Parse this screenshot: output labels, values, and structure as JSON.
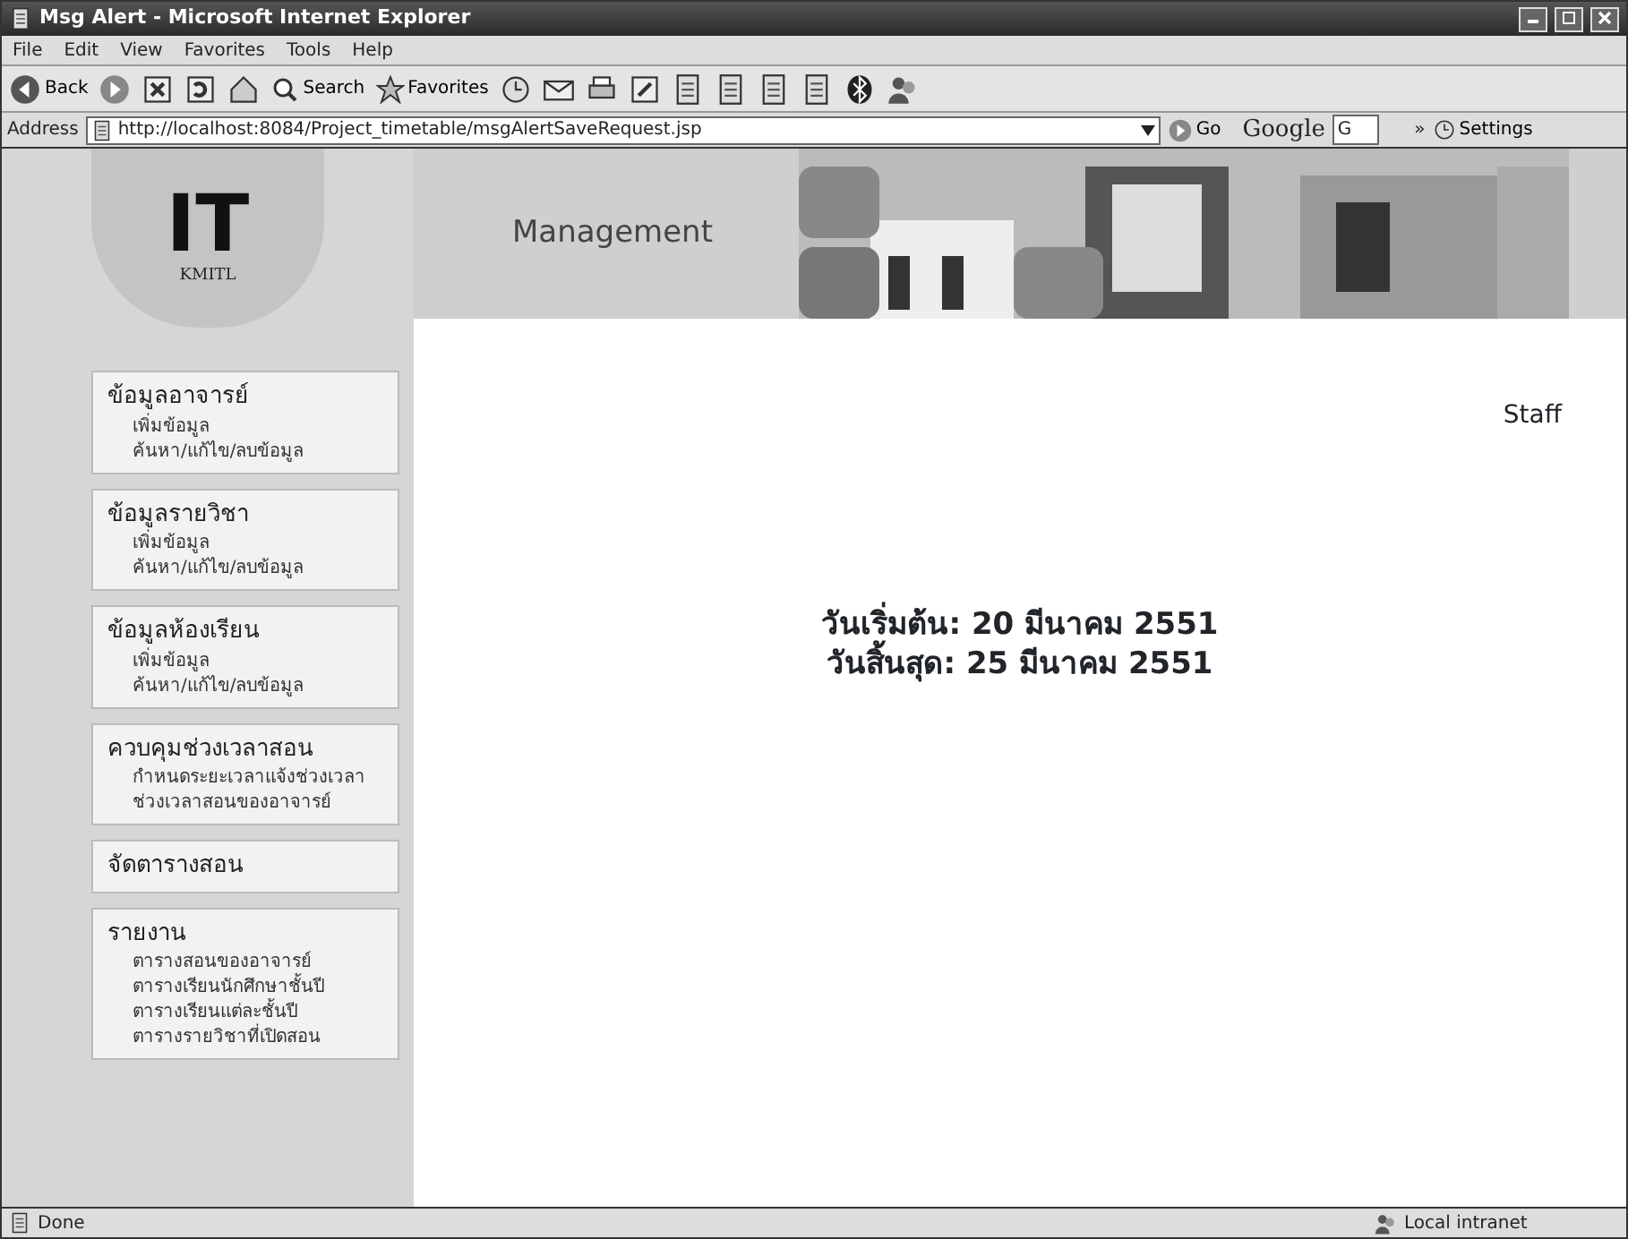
{
  "window": {
    "title": "Msg Alert - Microsoft Internet Explorer"
  },
  "menu": [
    "File",
    "Edit",
    "View",
    "Favorites",
    "Tools",
    "Help"
  ],
  "toolbar": [
    {
      "kind": "labeled",
      "label": "Back"
    },
    {
      "kind": "labeled",
      "label": "Search"
    },
    {
      "kind": "labeled",
      "label": "Favorites"
    }
  ],
  "address": {
    "label": "Address",
    "url": "http://localhost:8084/Project_timetable/msgAlertSaveRequest.jsp",
    "go": "Go",
    "google": "Google",
    "google_box": "G",
    "more": "»",
    "settings": "Settings"
  },
  "header": {
    "logo_text": "IT",
    "logo_sub": "KMITL",
    "banner_text": "Management"
  },
  "sidebar": [
    {
      "title": "ข้อมูลอาจารย์",
      "items": [
        "เพิ่มข้อมูล",
        "ค้นหา/แก้ไข/ลบข้อมูล"
      ]
    },
    {
      "title": "ข้อมูลรายวิชา",
      "items": [
        "เพิ่มข้อมูล",
        "ค้นหา/แก้ไข/ลบข้อมูล"
      ]
    },
    {
      "title": "ข้อมูลห้องเรียน",
      "items": [
        "เพิ่มข้อมูล",
        "ค้นหา/แก้ไข/ลบข้อมูล"
      ]
    },
    {
      "title": "ควบคุมช่วงเวลาสอน",
      "items": [
        "กำหนดระยะเวลาแจ้งช่วงเวลา",
        "ช่วงเวลาสอนของอาจารย์"
      ]
    },
    {
      "title": "จัดตารางสอน"
    },
    {
      "title": "รายงาน",
      "items": [
        "ตารางสอนของอาจารย์",
        "ตารางเรียนนักศึกษาชั้นปี",
        "ตารางเรียนแต่ละชั้นปี",
        "ตารางรายวิชาที่เปิดสอน"
      ]
    }
  ],
  "user": "Staff",
  "message": [
    "วันเริ่มต้น: 20 มีนาคม 2551",
    "วันสิ้นสุด: 25 มีนาคม 2551"
  ],
  "status_bar": {
    "text": "Done",
    "zone": "Local intranet"
  }
}
